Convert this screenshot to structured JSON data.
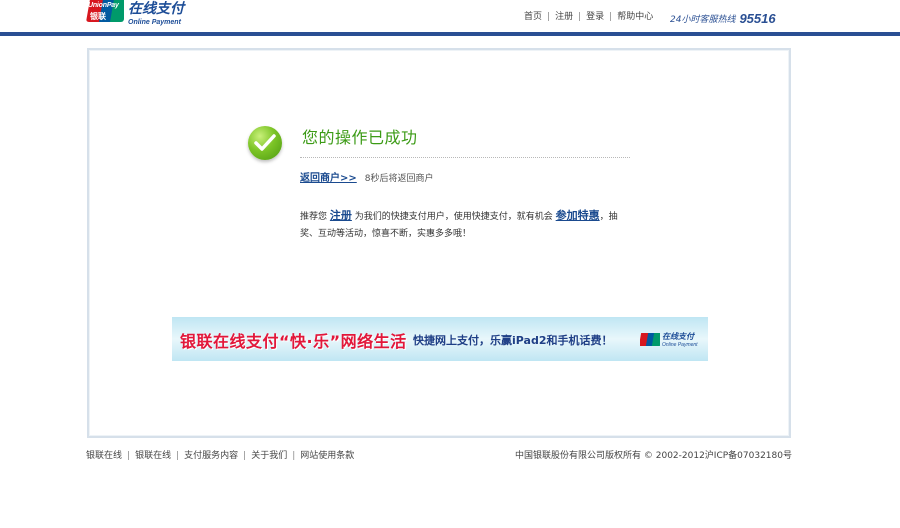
{
  "header": {
    "logo_mark_en": "UnionPay",
    "logo_mark_cn": "银联",
    "logo_title_cn": "在线支付",
    "logo_title_en": "Online Payment",
    "nav": [
      {
        "label": "首页"
      },
      {
        "label": "注册"
      },
      {
        "label": "登录"
      },
      {
        "label": "帮助中心"
      }
    ],
    "hotline_label": "24小时客服热线",
    "hotline_number": "95516",
    "bar_color": "#2a4f93"
  },
  "main": {
    "success_icon": "check-circle-icon",
    "success_title": "您的操作已成功",
    "return_link": "返回商户>>",
    "countdown": "8秒后将返回商户",
    "promo_prefix": "推荐您",
    "promo_register": "注册",
    "promo_middle": "为我们的快捷支付用户，使用快捷支付，就有机会",
    "promo_join": "参加特惠",
    "promo_suffix": "，抽奖、互动等活动，惊喜不断，实惠多多哦！"
  },
  "banner": {
    "main_text": "银联在线支付“快·乐”网络生活",
    "sub_text": "快捷网上支付，乐赢iPad2和手机话费！",
    "logo_cn": "在线支付",
    "logo_en": "Online Payment"
  },
  "footer": {
    "links": [
      {
        "label": "银联在线"
      },
      {
        "label": "银联在线"
      },
      {
        "label": "支付服务内容"
      },
      {
        "label": "关于我们"
      },
      {
        "label": "网站使用条款"
      }
    ],
    "copyright": "中国银联股份有限公司版权所有 © 2002-2012沪ICP备07032180号"
  }
}
